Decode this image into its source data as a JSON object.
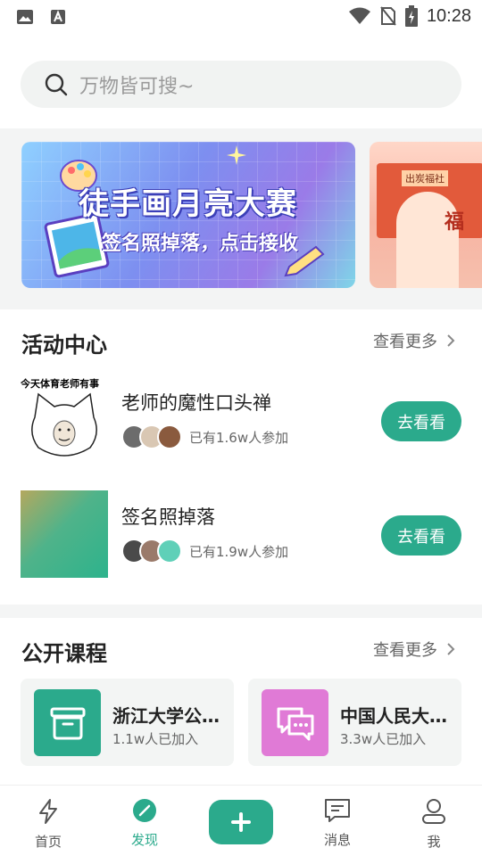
{
  "status_bar": {
    "time": "10:28"
  },
  "search": {
    "placeholder": "万物皆可搜~"
  },
  "banners": [
    {
      "title": "徒手画月亮大赛",
      "subtitle": "签名照掉落，点击接收"
    },
    {
      "sign": "出炭福社",
      "char": "福"
    }
  ],
  "activity": {
    "title": "活动中心",
    "more": "查看更多",
    "items": [
      {
        "thumb_caption": "今天体育老师有事",
        "name": "老师的魔性口头禅",
        "joined": "已有1.6w人参加",
        "button": "去看看"
      },
      {
        "name": "签名照掉落",
        "joined": "已有1.9w人参加",
        "button": "去看看"
      }
    ]
  },
  "courses": {
    "title": "公开课程",
    "more": "查看更多",
    "items": [
      {
        "title": "浙江大学公开课",
        "count": "1.1w人已加入",
        "icon": "archive-box-icon",
        "color": "#2baa8c"
      },
      {
        "title": "中国人民大学公开课",
        "count": "3.3w人已加入",
        "icon": "chat-bubbles-icon",
        "color": "#e07ad6"
      }
    ]
  },
  "tabbar": {
    "items": [
      {
        "label": "首页",
        "icon": "lightning-icon"
      },
      {
        "label": "发现",
        "icon": "compass-icon",
        "active": true
      },
      {
        "label": "",
        "icon": "plus-icon"
      },
      {
        "label": "消息",
        "icon": "message-icon"
      },
      {
        "label": "我",
        "icon": "user-icon"
      }
    ]
  },
  "colors": {
    "accent": "#2baa8c",
    "course_pink": "#e07ad6"
  }
}
